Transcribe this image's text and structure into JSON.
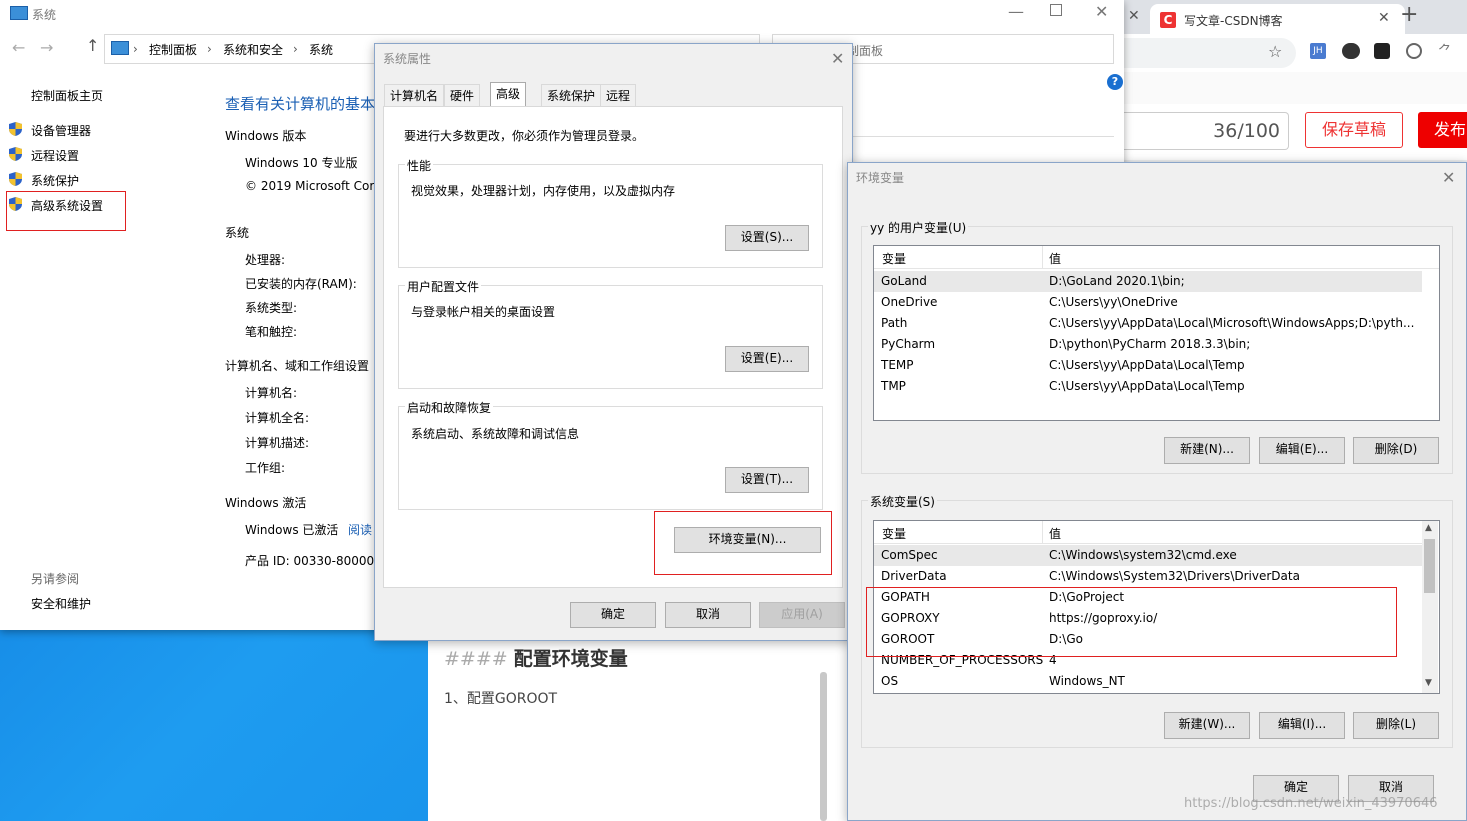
{
  "system_window": {
    "title": "系统",
    "breadcrumb": [
      "控制面板",
      "系统和安全",
      "系统"
    ],
    "sidebar_home": "控制面板主页",
    "sidebar_items": [
      "设备管理器",
      "远程设置",
      "系统保护",
      "高级系统设置"
    ],
    "see_also_title": "另请参阅",
    "see_also_item": "安全和维护",
    "heading": "查看有关计算机的基本",
    "win_version_title": "Windows 版本",
    "win_edition": "Windows 10 专业版",
    "copyright": "© 2019 Microsoft Cor",
    "system_title": "系统",
    "system_rows": [
      "处理器:",
      "已安装的内存(RAM):",
      "系统类型:",
      "笔和触控:"
    ],
    "computer_title": "计算机名、域和工作组设置",
    "computer_rows": [
      "计算机名:",
      "计算机全名:",
      "计算机描述:",
      "工作组:"
    ],
    "activation_title": "Windows 激活",
    "activation_status": "Windows 已激活",
    "activation_link": "阅读",
    "product_id": "产品 ID: 00330-80000-",
    "search_placeholder": "制面板"
  },
  "browser": {
    "tab_title": "写文章-CSDN博客",
    "counter": "36/100",
    "save_draft": "保存草稿",
    "publish": "发布",
    "editor_heading_prefix": "####",
    "editor_heading": "配置环境变量",
    "editor_line": "1、配置GOROOT",
    "watermark": "https://blog.csdn.net/weixin_43970646",
    "ext_jh": "JH"
  },
  "sys_props": {
    "title": "系统属性",
    "tabs": [
      "计算机名",
      "硬件",
      "高级",
      "系统保护",
      "远程"
    ],
    "admin_note": "要进行大多数更改，你必须作为管理员登录。",
    "perf_title": "性能",
    "perf_desc": "视觉效果，处理器计划，内存使用，以及虚拟内存",
    "perf_btn": "设置(S)...",
    "profile_title": "用户配置文件",
    "profile_desc": "与登录帐户相关的桌面设置",
    "profile_btn": "设置(E)...",
    "startup_title": "启动和故障恢复",
    "startup_desc": "系统启动、系统故障和调试信息",
    "startup_btn": "设置(T)...",
    "env_btn": "环境变量(N)...",
    "ok": "确定",
    "cancel": "取消",
    "apply": "应用(A)"
  },
  "env_vars": {
    "title": "环境变量",
    "user_group": "yy 的用户变量(U)",
    "col_var": "变量",
    "col_val": "值",
    "user_rows": [
      {
        "name": "GoLand",
        "value": "D:\\GoLand 2020.1\\bin;"
      },
      {
        "name": "OneDrive",
        "value": "C:\\Users\\yy\\OneDrive"
      },
      {
        "name": "Path",
        "value": "C:\\Users\\yy\\AppData\\Local\\Microsoft\\WindowsApps;D:\\pyth..."
      },
      {
        "name": "PyCharm",
        "value": "D:\\python\\PyCharm 2018.3.3\\bin;"
      },
      {
        "name": "TEMP",
        "value": "C:\\Users\\yy\\AppData\\Local\\Temp"
      },
      {
        "name": "TMP",
        "value": "C:\\Users\\yy\\AppData\\Local\\Temp"
      }
    ],
    "user_new": "新建(N)...",
    "user_edit": "编辑(E)...",
    "user_delete": "删除(D)",
    "sys_group": "系统变量(S)",
    "sys_rows": [
      {
        "name": "ComSpec",
        "value": "C:\\Windows\\system32\\cmd.exe"
      },
      {
        "name": "DriverData",
        "value": "C:\\Windows\\System32\\Drivers\\DriverData"
      },
      {
        "name": "GOPATH",
        "value": "D:\\GoProject"
      },
      {
        "name": "GOPROXY",
        "value": "https://goproxy.io/"
      },
      {
        "name": "GOROOT",
        "value": "D:\\Go"
      },
      {
        "name": "NUMBER_OF_PROCESSORS",
        "value": "4"
      },
      {
        "name": "OS",
        "value": "Windows_NT"
      }
    ],
    "sys_new": "新建(W)...",
    "sys_edit": "编辑(I)...",
    "sys_delete": "删除(L)",
    "ok": "确定",
    "cancel": "取消"
  },
  "colors": {
    "accent_red": "#e02020",
    "link_blue": "#1a5fb4",
    "csdn_red": "#e33"
  }
}
